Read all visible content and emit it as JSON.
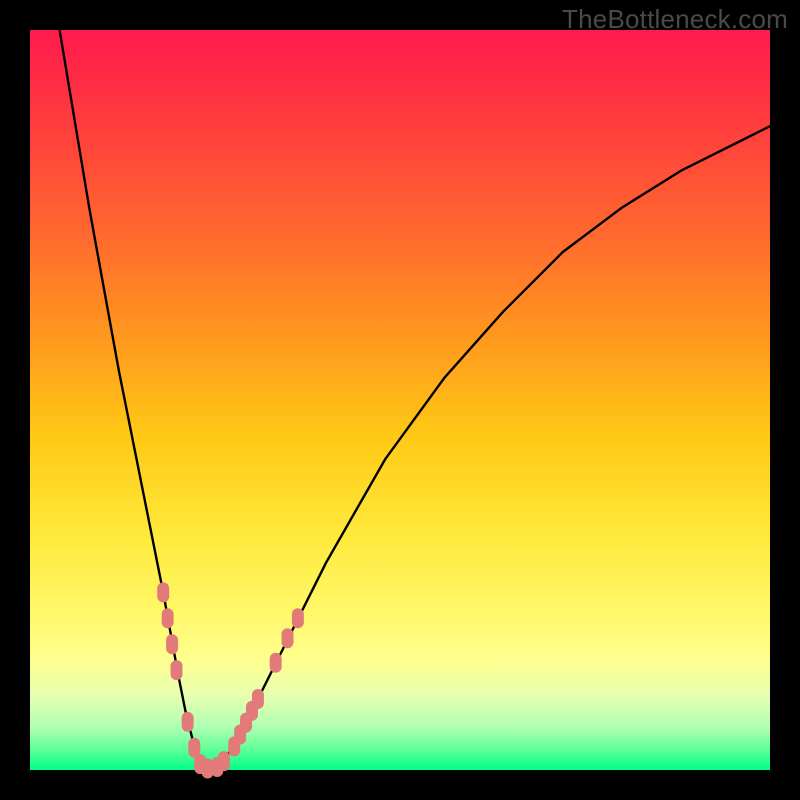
{
  "watermark": "TheBottleneck.com",
  "chart_data": {
    "type": "line",
    "title": "",
    "xlabel": "",
    "ylabel": "",
    "xlim": [
      0,
      100
    ],
    "ylim": [
      0,
      100
    ],
    "series": [
      {
        "name": "bottleneck-curve",
        "x": [
          4,
          6,
          8,
          10,
          12,
          14,
          16,
          18,
          20,
          21,
          22,
          23,
          24,
          25,
          26,
          28,
          30,
          34,
          40,
          48,
          56,
          64,
          72,
          80,
          88,
          96,
          100
        ],
        "values": [
          100,
          88,
          76,
          65,
          54,
          44,
          34,
          24,
          13,
          8,
          4,
          1,
          0,
          0,
          1,
          4,
          8,
          16,
          28,
          42,
          53,
          62,
          70,
          76,
          81,
          85,
          87
        ]
      }
    ],
    "markers": [
      {
        "x": 18.0,
        "y": 24.0
      },
      {
        "x": 18.6,
        "y": 20.5
      },
      {
        "x": 19.2,
        "y": 17.0
      },
      {
        "x": 19.8,
        "y": 13.5
      },
      {
        "x": 21.3,
        "y": 6.5
      },
      {
        "x": 22.2,
        "y": 3.0
      },
      {
        "x": 23.0,
        "y": 0.8
      },
      {
        "x": 24.0,
        "y": 0.2
      },
      {
        "x": 25.3,
        "y": 0.4
      },
      {
        "x": 26.2,
        "y": 1.2
      },
      {
        "x": 27.6,
        "y": 3.2
      },
      {
        "x": 28.4,
        "y": 4.8
      },
      {
        "x": 29.2,
        "y": 6.4
      },
      {
        "x": 30.0,
        "y": 8.0
      },
      {
        "x": 30.8,
        "y": 9.6
      },
      {
        "x": 33.2,
        "y": 14.5
      },
      {
        "x": 34.8,
        "y": 17.8
      },
      {
        "x": 36.2,
        "y": 20.5
      }
    ],
    "marker_color": "#e27a7a",
    "curve_color": "#000000",
    "gradient_stops": [
      {
        "pos": 0,
        "color": "#ff1a4d"
      },
      {
        "pos": 100,
        "color": "#00ff88"
      }
    ]
  }
}
